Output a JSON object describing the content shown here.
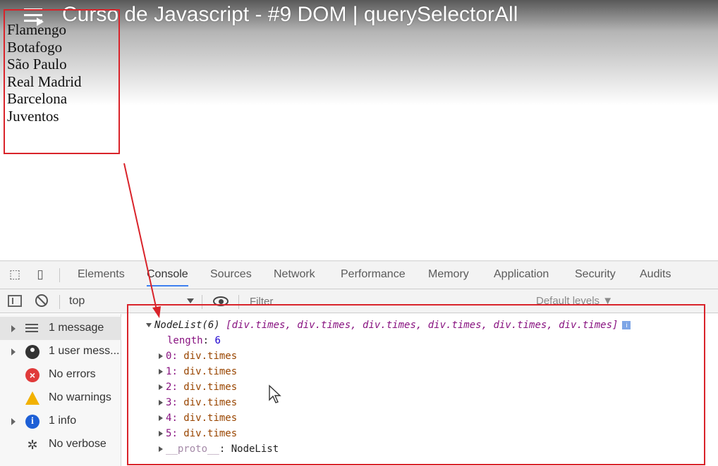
{
  "video": {
    "title": "Curso de Javascript - #9 DOM | querySelectorAll"
  },
  "page": {
    "teams": [
      "Flamengo",
      "Botafogo",
      "São Paulo",
      "Real Madrid",
      "Barcelona",
      "Juventos"
    ]
  },
  "devtools": {
    "tabs": [
      "Elements",
      "Console",
      "Sources",
      "Network",
      "Performance",
      "Memory",
      "Application",
      "Security",
      "Audits"
    ],
    "active_tab": "Console",
    "context": "top",
    "filter_placeholder": "Filter",
    "levels": "Default levels ▼",
    "sidebar": [
      {
        "label": "1 message",
        "icon": "list-icon",
        "expandable": true
      },
      {
        "label": "1 user mess...",
        "icon": "user-icon",
        "expandable": true
      },
      {
        "label": "No errors",
        "icon": "error-icon",
        "expandable": false
      },
      {
        "label": "No warnings",
        "icon": "warning-icon",
        "expandable": false
      },
      {
        "label": "1 info",
        "icon": "info-icon",
        "expandable": true
      },
      {
        "label": "No verbose",
        "icon": "bug-icon",
        "expandable": false
      }
    ],
    "output": {
      "head": "NodeList(6)",
      "items_summary": "[div.times, div.times, div.times, div.times, div.times, div.times]",
      "length_key": "length",
      "length_value": "6",
      "entries": [
        {
          "key": "0",
          "value": "div.times"
        },
        {
          "key": "1",
          "value": "div.times"
        },
        {
          "key": "2",
          "value": "div.times"
        },
        {
          "key": "3",
          "value": "div.times"
        },
        {
          "key": "4",
          "value": "div.times"
        },
        {
          "key": "5",
          "value": "div.times"
        }
      ],
      "proto_key": "__proto__",
      "proto_value": "NodeList"
    }
  },
  "colors": {
    "highlight": "#d9232a",
    "active_tab_underline": "#3e80f0"
  }
}
